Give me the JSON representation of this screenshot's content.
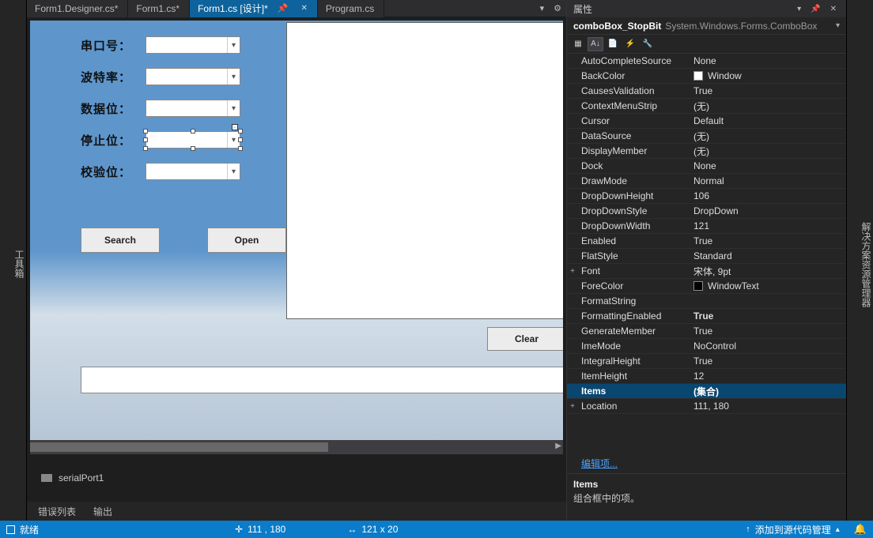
{
  "left_strip": "工具箱",
  "right_strip": "解决方案资源管理器",
  "tabs": {
    "t0": "Form1.Designer.cs*",
    "t1": "Form1.cs*",
    "t2": "Form1.cs [设计]*",
    "t3": "Program.cs"
  },
  "form": {
    "labels": {
      "port": "串口号：",
      "baud": "波特率：",
      "databit": "数据位：",
      "stopbit": "停止位：",
      "parity": "校验位："
    },
    "buttons": {
      "search": "Search",
      "open": "Open",
      "clear": "Clear"
    }
  },
  "tray": {
    "serial": "serialPort1"
  },
  "bottomTabs": {
    "err": "错误列表",
    "out": "输出"
  },
  "props": {
    "title": "属性",
    "selected_name": "comboBox_StopBit",
    "selected_type": "System.Windows.Forms.ComboBox",
    "rows": [
      {
        "n": "AutoCompleteSource",
        "v": "None"
      },
      {
        "n": "BackColor",
        "v": "Window",
        "swatch": "#ffffff"
      },
      {
        "n": "CausesValidation",
        "v": "True"
      },
      {
        "n": "ContextMenuStrip",
        "v": "(无)"
      },
      {
        "n": "Cursor",
        "v": "Default"
      },
      {
        "n": "DataSource",
        "v": "(无)"
      },
      {
        "n": "DisplayMember",
        "v": "(无)"
      },
      {
        "n": "Dock",
        "v": "None"
      },
      {
        "n": "DrawMode",
        "v": "Normal"
      },
      {
        "n": "DropDownHeight",
        "v": "106"
      },
      {
        "n": "DropDownStyle",
        "v": "DropDown"
      },
      {
        "n": "DropDownWidth",
        "v": "121"
      },
      {
        "n": "Enabled",
        "v": "True"
      },
      {
        "n": "FlatStyle",
        "v": "Standard"
      },
      {
        "n": "Font",
        "v": "宋体, 9pt",
        "exp": "+"
      },
      {
        "n": "ForeColor",
        "v": "WindowText",
        "swatch": "#000000"
      },
      {
        "n": "FormatString",
        "v": ""
      },
      {
        "n": "FormattingEnabled",
        "v": "True",
        "bold": true
      },
      {
        "n": "GenerateMember",
        "v": "True"
      },
      {
        "n": "ImeMode",
        "v": "NoControl"
      },
      {
        "n": "IntegralHeight",
        "v": "True"
      },
      {
        "n": "ItemHeight",
        "v": "12"
      },
      {
        "n": "Items",
        "v": "(集合)",
        "sel": true
      },
      {
        "n": "Location",
        "v": "111, 180",
        "exp": "+"
      }
    ],
    "link": "编辑项...",
    "desc_title": "Items",
    "desc_body": "组合框中的项。"
  },
  "status": {
    "ready": "就绪",
    "pos": "111 , 180",
    "size": "121 x 20",
    "scm": "添加到源代码管理"
  }
}
